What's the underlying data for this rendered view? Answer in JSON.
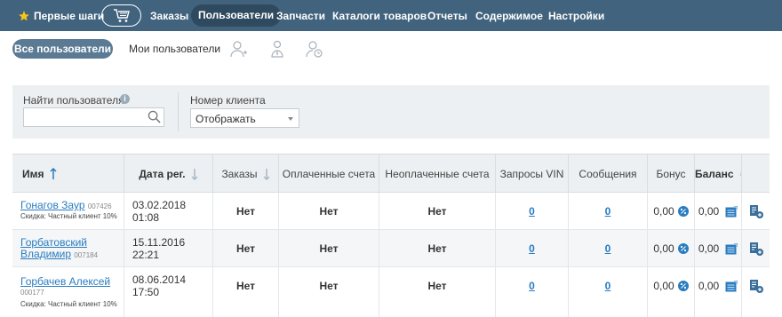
{
  "nav": {
    "first_steps": "Первые шаги",
    "items": [
      "Заказы",
      "Пользователи",
      "Запчасти",
      "Каталоги товаров",
      "Отчеты",
      "Содержимое",
      "Настройки"
    ],
    "active": "Пользователи"
  },
  "subtabs": {
    "all_users": "Все пользователи",
    "my_users": "Мои пользователи"
  },
  "filter": {
    "find_user_label": "Найти пользователя",
    "find_user_value": "",
    "client_number_label": "Номер клиента",
    "client_number_selected": "Отображать"
  },
  "table": {
    "headers": [
      "Имя",
      "Дата рег.",
      "Заказы",
      "Оплаченные счета",
      "Неоплаченные счета",
      "Запросы VIN",
      "Сообщения",
      "Бонус",
      "Баланс"
    ],
    "rows": [
      {
        "name": "Гонагов Заур",
        "id": "007426",
        "discount": "Скидка: Частный клиент 10%",
        "date": "03.02.2018 01:08",
        "orders": "Нет",
        "paid": "Нет",
        "unpaid": "Нет",
        "vin": "0",
        "messages": "0",
        "bonus": "0,00",
        "balance": "0,00"
      },
      {
        "name": "Горбатовский",
        "name2": "Владимир",
        "id": "007184",
        "discount": "",
        "date": "15.11.2016 22:21",
        "orders": "Нет",
        "paid": "Нет",
        "unpaid": "Нет",
        "vin": "0",
        "messages": "0",
        "bonus": "0,00",
        "balance": "0,00"
      },
      {
        "name": "Горбачев Алексей",
        "id": "000177",
        "discount": "Скидка: Частный клиент 10%",
        "date": "08.06.2014 17:50",
        "orders": "Нет",
        "paid": "Нет",
        "unpaid": "Нет",
        "vin": "0",
        "messages": "0",
        "bonus": "0,00",
        "balance": "0,00"
      }
    ]
  },
  "colors": {
    "nav_bg": "#41637e",
    "nav_active": "#2f4a5f",
    "accent": "#2a7cc0",
    "star": "#f5c518"
  }
}
